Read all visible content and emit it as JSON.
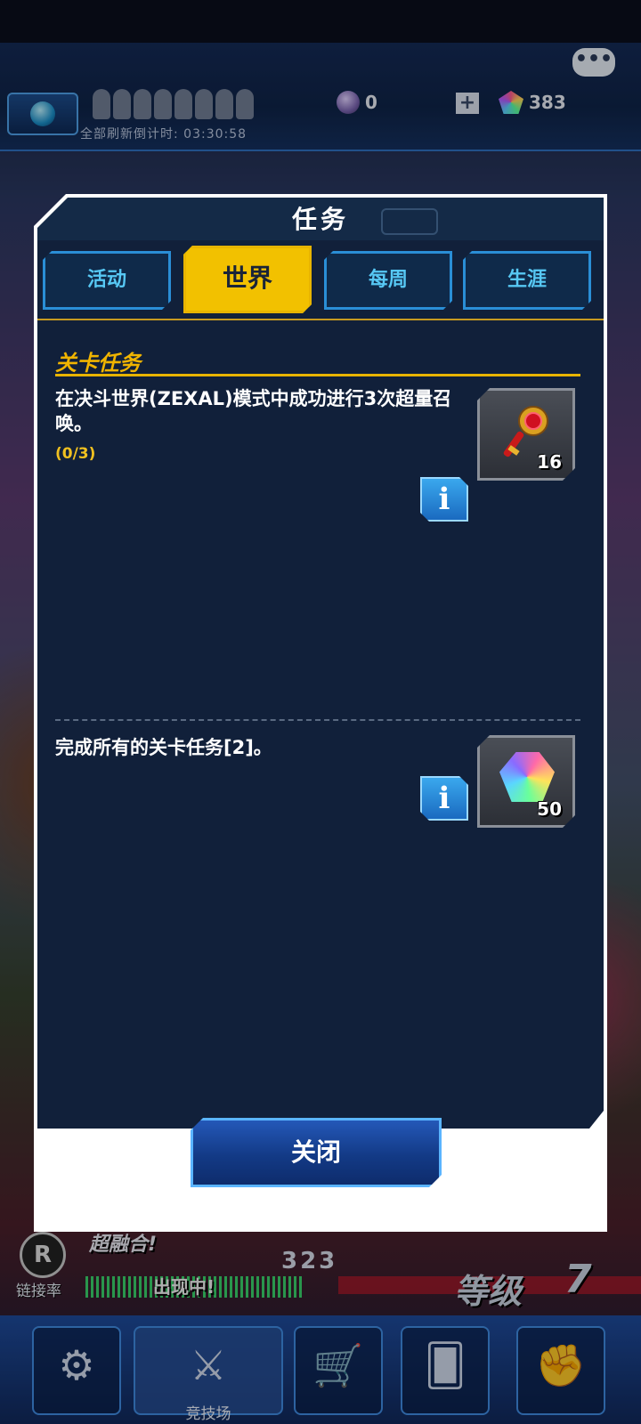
{
  "top_bar": {
    "refresh_countdown": "全部刷新倒计时: 03:30:58",
    "currency_orb": "0",
    "currency_gems": "383"
  },
  "modal": {
    "title": "任务",
    "tabs": [
      {
        "label": "活动",
        "active": false
      },
      {
        "label": "世界",
        "active": true
      },
      {
        "label": "每周",
        "active": false
      },
      {
        "label": "生涯",
        "active": false
      }
    ],
    "section_title": "关卡任务",
    "quests": [
      {
        "text": "在决斗世界(ZEXAL)模式中成功进行3次超量召唤。",
        "progress": "(0/3)",
        "reward_icon": "key-icon",
        "reward_count": "16"
      },
      {
        "text": "完成所有的关卡任务[2]。",
        "progress": "",
        "reward_icon": "gem-icon",
        "reward_count": "50"
      }
    ],
    "info_label": "i",
    "close_label": "关闭"
  },
  "hud": {
    "fusion_label": "超融合!",
    "link_rate_label": "链接率",
    "link_rate_value": "323",
    "appearing_label": "出现中!",
    "level_label": "等级",
    "level_value": "7",
    "arena_label": "竞技场"
  },
  "colors": {
    "accent_gold": "#f2c100",
    "tab_blue": "#2a8ed6",
    "panel_navy": "#11203a",
    "progress_yellow": "#f0c020"
  }
}
